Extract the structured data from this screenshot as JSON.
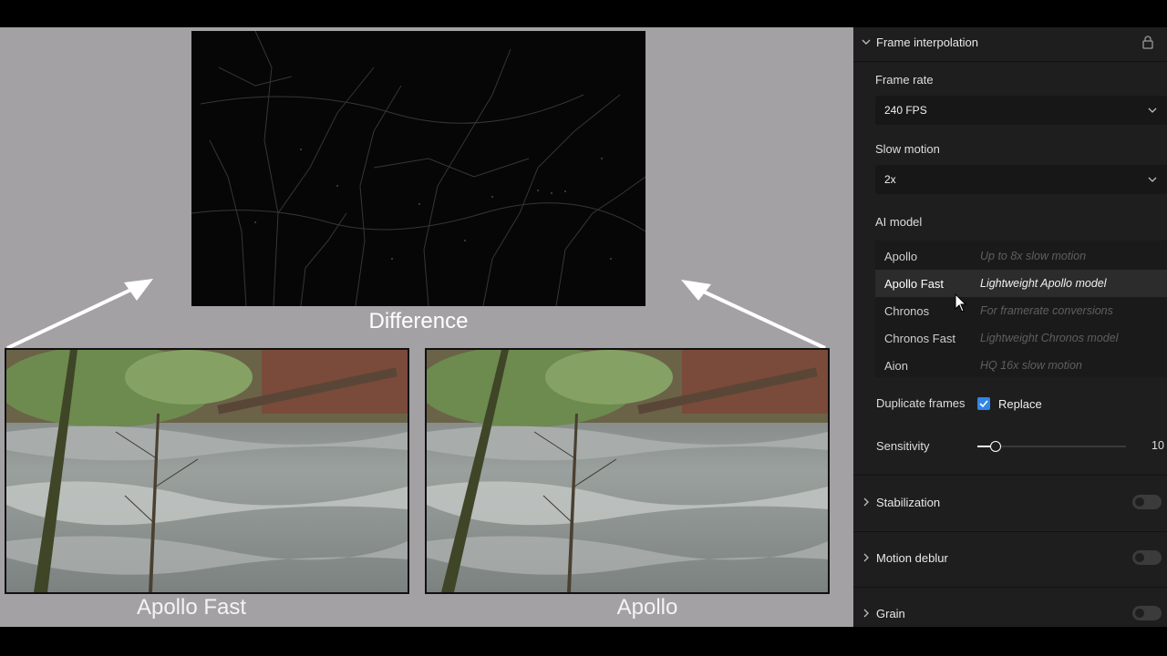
{
  "captions": {
    "difference": "Difference",
    "left": "Apollo Fast",
    "right": "Apollo"
  },
  "panel": {
    "section_title": "Frame interpolation",
    "frame_rate": {
      "label": "Frame rate",
      "value": "240 FPS"
    },
    "slow_motion": {
      "label": "Slow motion",
      "value": "2x"
    },
    "ai_model": {
      "label": "AI model",
      "items": [
        {
          "name": "Apollo",
          "desc": "Up to 8x slow motion"
        },
        {
          "name": "Apollo Fast",
          "desc": "Lightweight Apollo model"
        },
        {
          "name": "Chronos",
          "desc": "For framerate conversions"
        },
        {
          "name": "Chronos Fast",
          "desc": "Lightweight Chronos model"
        },
        {
          "name": "Aion",
          "desc": "HQ 16x slow motion"
        }
      ],
      "selected": "Apollo Fast"
    },
    "duplicate_frames": {
      "label": "Duplicate frames",
      "checkbox_label": "Replace",
      "checked": true
    },
    "sensitivity": {
      "label": "Sensitivity",
      "value": "10",
      "fill_fraction": 0.12
    },
    "collapsed_sections": [
      {
        "title": "Stabilization",
        "enabled": false
      },
      {
        "title": "Motion deblur",
        "enabled": false
      },
      {
        "title": "Grain",
        "enabled": false
      }
    ]
  },
  "colors": {
    "accent": "#2f86e8",
    "panel_bg": "#1e1e1e",
    "compare_bg": "#a3a1a4"
  },
  "icons": {
    "section_expand": "chevron-down-icon",
    "lock": "lock-icon",
    "dropdown": "chevron-down-icon",
    "collapsed": "chevron-right-icon",
    "checkbox": "checkmark-icon"
  }
}
